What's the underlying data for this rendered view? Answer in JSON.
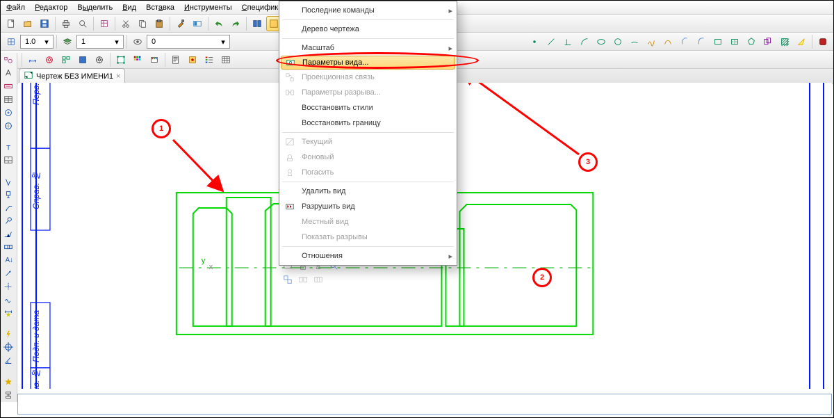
{
  "menu": {
    "file": "Файл",
    "editor": "Редактор",
    "select": "Выделить",
    "view": "Вид",
    "insert": "Вставка",
    "tools": "Инструменты",
    "spec": "Спецификация"
  },
  "toolbar1": {
    "lineWidth": "1.0",
    "layerCombo": "1",
    "zoom": "0"
  },
  "tabTitle": "Чертеж БЕЗ ИМЕНИ1",
  "context": {
    "recent": "Последние команды",
    "tree": "Дерево чертежа",
    "scale": "Масштаб",
    "viewParams": "Параметры вида...",
    "projLink": "Проекционная связь",
    "breakParams": "Параметры разрыва...",
    "restoreStyles": "Восстановить стили",
    "restoreBounds": "Восстановить границу",
    "current": "Текущий",
    "bg": "Фоновый",
    "off": "Погасить",
    "delView": "Удалить вид",
    "destroyView": "Разрушить вид",
    "localView": "Местный вид",
    "showBreaks": "Показать разрывы",
    "relations": "Отношения"
  },
  "sideCells": {
    "c1": "Перв. пр",
    "c2": "Справ. №",
    "c3": "Подп. и дата",
    "c4": "нв. №"
  },
  "annotations": {
    "a1": "1",
    "a2": "2",
    "a3": "3"
  }
}
